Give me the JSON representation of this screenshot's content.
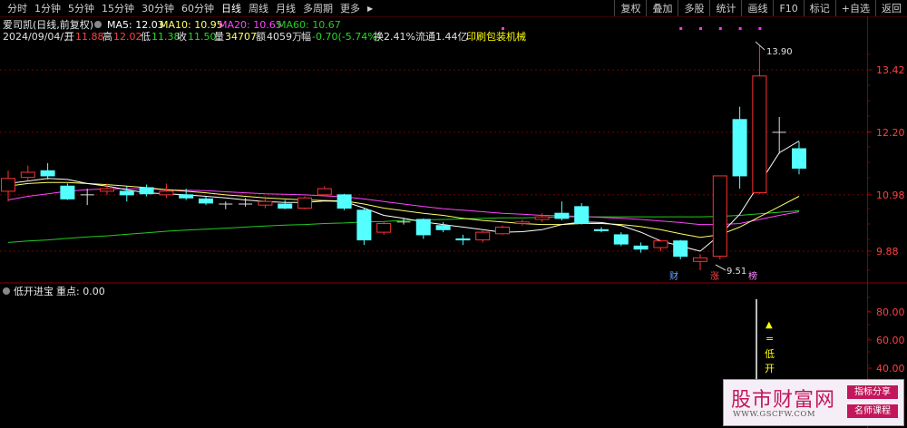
{
  "toolbar": {
    "periods": [
      "分时",
      "1分钟",
      "5分钟",
      "15分钟",
      "30分钟",
      "60分钟",
      "日线",
      "周线",
      "月线",
      "多周期",
      "更多"
    ],
    "active_period": "日线",
    "more_arrow": "▶",
    "right_buttons": [
      "复权",
      "叠加",
      "多股",
      "统计",
      "画线",
      "F10",
      "标记",
      "+自选",
      "返回"
    ]
  },
  "stock": {
    "name": "爱司凯(日线,前复权)",
    "ma5": "MA5: 12.03",
    "ma10": "MA10: 10.95",
    "ma20": "MA20: 10.65",
    "ma60": "MA60: 10.67"
  },
  "info": {
    "date": "2024/09/04/三",
    "open_label": "开",
    "open": "11.88",
    "high_label": "高",
    "high": "12.02",
    "low_label": "低",
    "low": "11.38",
    "close_label": "收",
    "close": "11.50",
    "vol_label": "量",
    "vol": "34707",
    "amount_label": "额",
    "amount": "4059万",
    "change_label": "幅",
    "change": "-0.70(-5.74%)",
    "turnover": "换2.41%",
    "float_cap": "流通1.44亿",
    "industry": "印刷包装机械"
  },
  "price_axis": [
    "13.42",
    "12.20",
    "10.98",
    "9.88"
  ],
  "annotations": {
    "high_label": "13.90",
    "low_label": "9.51",
    "marker_cai": "财",
    "marker_zhang": "涨",
    "marker_bang": "榜"
  },
  "indicator": {
    "name": "低开进宝",
    "key_label": "重点: 0.00",
    "axis": [
      "80.00",
      "60.00",
      "40.00"
    ],
    "signal_arrow": "▲",
    "signal_eq": "=",
    "signal_text1": "低",
    "signal_text2": "开"
  },
  "watermark": {
    "title": "股市财富网",
    "url": "WWW.GSCFW.COM",
    "tag1": "指标分享",
    "tag2": "名师课程"
  },
  "colors": {
    "up": "#ff3232",
    "down": "#54ffff",
    "ma5": "#ffffff",
    "ma10": "#ffff66",
    "ma20": "#ff44ff",
    "ma60": "#22cc22",
    "grid": "#7a0000",
    "axis_text": "#ff4040"
  },
  "chart_data": {
    "type": "candlestick",
    "price_ticks": [
      13.42,
      12.2,
      10.98,
      9.88
    ],
    "candles": [
      {
        "o": 11.05,
        "h": 11.45,
        "l": 10.85,
        "c": 11.3
      },
      {
        "o": 11.32,
        "h": 11.55,
        "l": 11.25,
        "c": 11.42
      },
      {
        "o": 11.45,
        "h": 11.6,
        "l": 11.28,
        "c": 11.35
      },
      {
        "o": 11.15,
        "h": 11.2,
        "l": 10.88,
        "c": 10.9
      },
      {
        "o": 10.98,
        "h": 11.1,
        "l": 10.78,
        "c": 10.98
      },
      {
        "o": 11.05,
        "h": 11.2,
        "l": 10.98,
        "c": 11.1
      },
      {
        "o": 11.05,
        "h": 11.15,
        "l": 10.85,
        "c": 10.98
      },
      {
        "o": 11.12,
        "h": 11.18,
        "l": 10.95,
        "c": 11.0
      },
      {
        "o": 10.98,
        "h": 11.2,
        "l": 10.92,
        "c": 11.05
      },
      {
        "o": 10.98,
        "h": 11.1,
        "l": 10.88,
        "c": 10.92
      },
      {
        "o": 10.9,
        "h": 10.95,
        "l": 10.78,
        "c": 10.82
      },
      {
        "o": 10.8,
        "h": 10.85,
        "l": 10.7,
        "c": 10.8
      },
      {
        "o": 10.8,
        "h": 10.92,
        "l": 10.75,
        "c": 10.8
      },
      {
        "o": 10.78,
        "h": 10.95,
        "l": 10.72,
        "c": 10.85
      },
      {
        "o": 10.8,
        "h": 10.88,
        "l": 10.7,
        "c": 10.72
      },
      {
        "o": 10.72,
        "h": 10.95,
        "l": 10.7,
        "c": 10.92
      },
      {
        "o": 10.98,
        "h": 11.15,
        "l": 10.95,
        "c": 11.1
      },
      {
        "o": 10.98,
        "h": 11.0,
        "l": 10.68,
        "c": 10.72
      },
      {
        "o": 10.68,
        "h": 10.72,
        "l": 10.0,
        "c": 10.1
      },
      {
        "o": 10.25,
        "h": 10.45,
        "l": 10.2,
        "c": 10.42
      },
      {
        "o": 10.45,
        "h": 10.52,
        "l": 10.4,
        "c": 10.45
      },
      {
        "o": 10.5,
        "h": 10.52,
        "l": 10.12,
        "c": 10.2
      },
      {
        "o": 10.38,
        "h": 10.45,
        "l": 10.25,
        "c": 10.3
      },
      {
        "o": 10.12,
        "h": 10.2,
        "l": 10.0,
        "c": 10.1
      },
      {
        "o": 10.1,
        "h": 10.28,
        "l": 10.05,
        "c": 10.25
      },
      {
        "o": 10.22,
        "h": 10.38,
        "l": 10.2,
        "c": 10.35
      },
      {
        "o": 10.42,
        "h": 10.5,
        "l": 10.38,
        "c": 10.45
      },
      {
        "o": 10.5,
        "h": 10.62,
        "l": 10.45,
        "c": 10.55
      },
      {
        "o": 10.62,
        "h": 10.85,
        "l": 10.48,
        "c": 10.52
      },
      {
        "o": 10.75,
        "h": 10.82,
        "l": 10.4,
        "c": 10.42
      },
      {
        "o": 10.3,
        "h": 10.35,
        "l": 10.25,
        "c": 10.28
      },
      {
        "o": 10.2,
        "h": 10.25,
        "l": 9.98,
        "c": 10.02
      },
      {
        "o": 9.98,
        "h": 10.05,
        "l": 9.85,
        "c": 9.92
      },
      {
        "o": 9.95,
        "h": 10.1,
        "l": 9.88,
        "c": 10.08
      },
      {
        "o": 10.08,
        "h": 10.1,
        "l": 9.72,
        "c": 9.78
      },
      {
        "o": 9.68,
        "h": 9.82,
        "l": 9.51,
        "c": 9.75
      },
      {
        "o": 9.78,
        "h": 11.35,
        "l": 9.72,
        "c": 11.35
      },
      {
        "o": 12.45,
        "h": 12.7,
        "l": 11.1,
        "c": 11.35
      },
      {
        "o": 11.02,
        "h": 13.9,
        "l": 11.0,
        "c": 13.3
      },
      {
        "o": 12.2,
        "h": 12.5,
        "l": 11.78,
        "c": 12.2
      },
      {
        "o": 11.88,
        "h": 12.02,
        "l": 11.38,
        "c": 11.5
      }
    ],
    "ma5": [
      11.2,
      11.25,
      11.3,
      11.28,
      11.2,
      11.15,
      11.08,
      11.02,
      11.0,
      10.98,
      10.95,
      10.92,
      10.88,
      10.85,
      10.83,
      10.83,
      10.86,
      10.85,
      10.72,
      10.58,
      10.52,
      10.45,
      10.4,
      10.35,
      10.3,
      10.25,
      10.26,
      10.3,
      10.4,
      10.45,
      10.44,
      10.38,
      10.25,
      10.08,
      9.98,
      9.88,
      10.2,
      10.6,
      11.2,
      11.8,
      12.03
    ],
    "ma10": [
      11.15,
      11.2,
      11.22,
      11.22,
      11.2,
      11.18,
      11.15,
      11.12,
      11.08,
      11.05,
      11.02,
      10.98,
      10.95,
      10.92,
      10.9,
      10.88,
      10.87,
      10.86,
      10.8,
      10.72,
      10.67,
      10.62,
      10.58,
      10.52,
      10.48,
      10.45,
      10.42,
      10.4,
      10.4,
      10.42,
      10.42,
      10.4,
      10.36,
      10.3,
      10.22,
      10.15,
      10.2,
      10.35,
      10.55,
      10.75,
      10.95
    ],
    "ma20": [
      10.88,
      10.95,
      11.0,
      11.05,
      11.08,
      11.1,
      11.1,
      11.1,
      11.08,
      11.07,
      11.06,
      11.04,
      11.02,
      11.0,
      10.99,
      10.98,
      10.96,
      10.94,
      10.9,
      10.85,
      10.8,
      10.75,
      10.71,
      10.68,
      10.65,
      10.62,
      10.6,
      10.58,
      10.57,
      10.56,
      10.54,
      10.52,
      10.5,
      10.47,
      10.44,
      10.4,
      10.4,
      10.42,
      10.5,
      10.58,
      10.65
    ],
    "ma60": [
      10.05,
      10.08,
      10.1,
      10.13,
      10.16,
      10.18,
      10.21,
      10.24,
      10.27,
      10.29,
      10.31,
      10.33,
      10.35,
      10.37,
      10.39,
      10.4,
      10.42,
      10.43,
      10.45,
      10.46,
      10.48,
      10.49,
      10.5,
      10.51,
      10.52,
      10.53,
      10.53,
      10.54,
      10.55,
      10.55,
      10.55,
      10.55,
      10.55,
      10.55,
      10.55,
      10.55,
      10.56,
      10.58,
      10.61,
      10.64,
      10.67
    ],
    "top_markers": [
      25,
      34,
      35,
      36,
      37,
      38
    ]
  }
}
